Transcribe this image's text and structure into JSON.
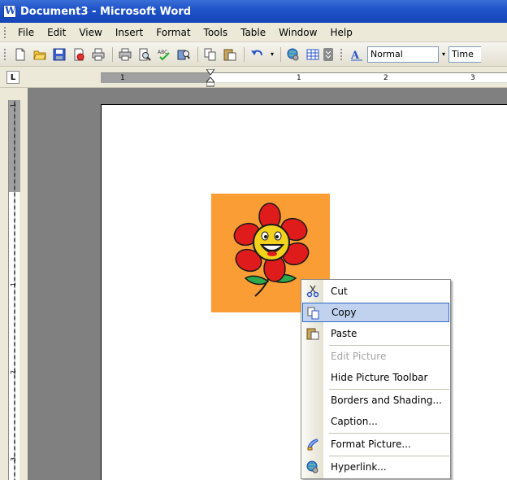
{
  "window": {
    "title": "Document3 - Microsoft Word"
  },
  "menubar": {
    "items": [
      {
        "label": "File",
        "name": "menu-file"
      },
      {
        "label": "Edit",
        "name": "menu-edit"
      },
      {
        "label": "View",
        "name": "menu-view"
      },
      {
        "label": "Insert",
        "name": "menu-insert"
      },
      {
        "label": "Format",
        "name": "menu-format"
      },
      {
        "label": "Tools",
        "name": "menu-tools"
      },
      {
        "label": "Table",
        "name": "menu-table"
      },
      {
        "label": "Window",
        "name": "menu-window"
      },
      {
        "label": "Help",
        "name": "menu-help"
      }
    ]
  },
  "toolbar": {
    "style_value": "Normal",
    "font_value": "Time"
  },
  "ruler": {
    "tab_selector": "L",
    "h_numbers": [
      "1",
      "1",
      "2",
      "3"
    ],
    "v_numbers": [
      "1",
      "1",
      "2",
      "3"
    ]
  },
  "context_menu": {
    "items": [
      {
        "label": "Cut",
        "icon": "scissors-icon",
        "state": "normal"
      },
      {
        "label": "Copy",
        "icon": "copy-icon",
        "state": "highlighted"
      },
      {
        "label": "Paste",
        "icon": "paste-icon",
        "state": "normal"
      },
      {
        "label": "Edit Picture",
        "icon": "",
        "state": "disabled"
      },
      {
        "label": "Hide Picture Toolbar",
        "icon": "",
        "state": "normal"
      },
      {
        "label": "Borders and Shading...",
        "icon": "",
        "state": "normal"
      },
      {
        "label": "Caption...",
        "icon": "",
        "state": "normal"
      },
      {
        "label": "Format Picture...",
        "icon": "format-picture-icon",
        "state": "normal"
      },
      {
        "label": "Hyperlink...",
        "icon": "hyperlink-icon",
        "state": "normal"
      }
    ]
  },
  "colors": {
    "titlebar": "#1f53c8",
    "picture_bg": "#f99d34",
    "highlight": "#c1d2ee"
  }
}
